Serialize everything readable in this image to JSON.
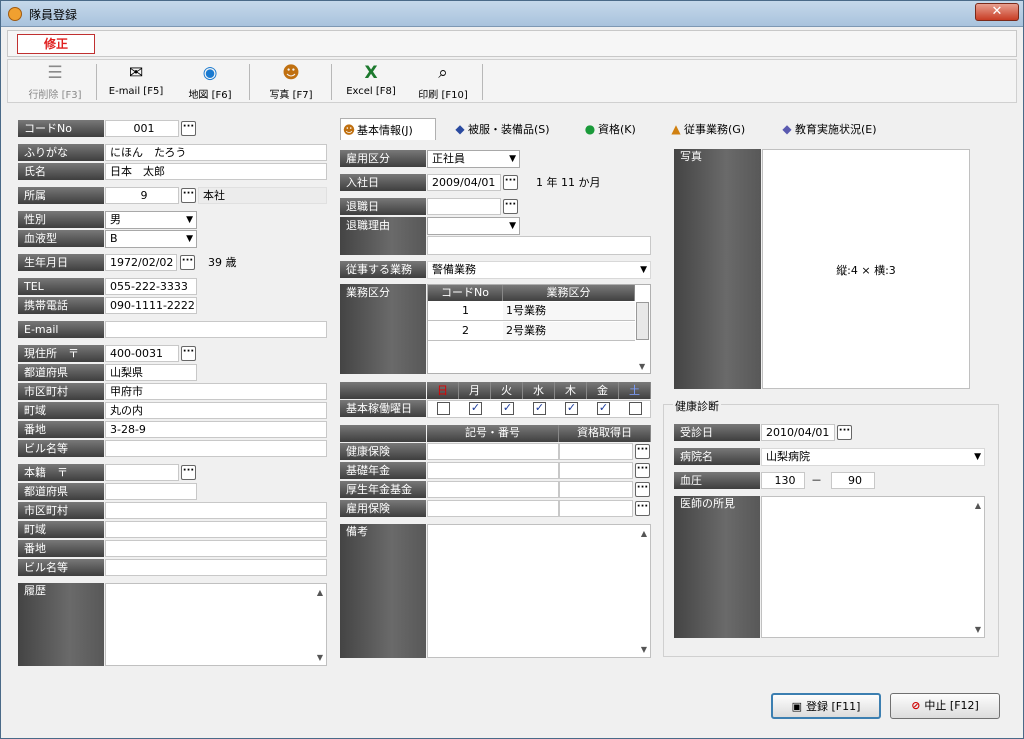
{
  "window": {
    "title": "隊員登録",
    "close": "✕"
  },
  "mode": "修正",
  "toolbar": [
    {
      "label": "行削除 [F3]",
      "icon": "delete-row-icon",
      "enabled": false
    },
    {
      "label": "E-mail [F5]",
      "icon": "email-icon",
      "enabled": true
    },
    {
      "label": "地図 [F6]",
      "icon": "map-icon",
      "enabled": true
    },
    {
      "label": "写真 [F7]",
      "icon": "photo-person-icon",
      "enabled": true
    },
    {
      "label": "Excel [F8]",
      "icon": "excel-icon",
      "enabled": true
    },
    {
      "label": "印刷 [F10]",
      "icon": "print-icon",
      "enabled": true
    }
  ],
  "left": {
    "code_label": "コードNo",
    "code": "001",
    "kana_label": "ふりがな",
    "kana": "にほん　たろう",
    "name_label": "氏名",
    "name": "日本　太郎",
    "affil_label": "所属",
    "affil_code": "9",
    "affil_name": "本社",
    "gender_label": "性別",
    "gender": "男",
    "blood_label": "血液型",
    "blood": "B",
    "birth_label": "生年月日",
    "birth": "1972/02/02",
    "age": "39 歳",
    "tel_label": "TEL",
    "tel": "055-222-3333",
    "mobile_label": "携帯電話",
    "mobile": "090-1111-2222",
    "email_label": "E-mail",
    "email": "",
    "addr_label": "現住所　〒",
    "zip": "400-0031",
    "pref_label": "都道府県",
    "pref": "山梨県",
    "city_label": "市区町村",
    "city": "甲府市",
    "town_label": "町域",
    "town": "丸の内",
    "banchi_label": "番地",
    "banchi": "3-28-9",
    "bldg_label": "ビル名等",
    "bldg": "",
    "honseki_label": "本籍　〒",
    "honseki_zip": "",
    "h_pref_label": "都道府県",
    "h_city_label": "市区町村",
    "h_town_label": "町域",
    "h_banchi_label": "番地",
    "h_bldg_label": "ビル名等",
    "history_label": "履歴"
  },
  "tabs": [
    {
      "label": "基本情報(J)",
      "icon": "person-icon",
      "active": true
    },
    {
      "label": "被服・装備品(S)",
      "icon": "equipment-icon",
      "active": false
    },
    {
      "label": "資格(K)",
      "icon": "license-icon",
      "active": false
    },
    {
      "label": "従事業務(G)",
      "icon": "work-icon",
      "active": false
    },
    {
      "label": "教育実施状況(E)",
      "icon": "education-icon",
      "active": false
    }
  ],
  "basic": {
    "employ_label": "雇用区分",
    "employ": "正社員",
    "join_label": "入社日",
    "join": "2009/04/01",
    "tenure": "1 年 11 か月",
    "leave_label": "退職日",
    "leave": "",
    "reason_label": "退職理由",
    "reason": "",
    "duty_label": "従事する業務",
    "duty": "警備業務",
    "cat_label": "業務区分",
    "cat_headers": [
      "コードNo",
      "業務区分"
    ],
    "cat_rows": [
      [
        "1",
        "1号業務"
      ],
      [
        "2",
        "2号業務"
      ]
    ],
    "days": [
      "日",
      "月",
      "火",
      "水",
      "木",
      "金",
      "土"
    ],
    "days_checked": [
      false,
      true,
      true,
      true,
      true,
      true,
      false
    ],
    "workday_label": "基本稼働曜日",
    "ins_headers": [
      "記号・番号",
      "資格取得日"
    ],
    "ins": [
      "健康保険",
      "基礎年金",
      "厚生年金基金",
      "雇用保険"
    ],
    "note_label": "備考"
  },
  "right": {
    "photo_label": "写真",
    "photo_text": "縦:4 × 横:3",
    "health_title": "健康診断",
    "exam_label": "受診日",
    "exam": "2010/04/01",
    "hosp_label": "病院名",
    "hosp": "山梨病院",
    "bp_label": "血圧",
    "bp_high": "130",
    "bp_dash": "－",
    "bp_low": "90",
    "doctor_label": "医師の所見"
  },
  "buttons": {
    "save": "登録 [F11]",
    "cancel": "中止 [F12]"
  },
  "colors": {
    "sunday": "#e00000",
    "saturday": "#1a3ad0",
    "mode": "#e02020"
  }
}
